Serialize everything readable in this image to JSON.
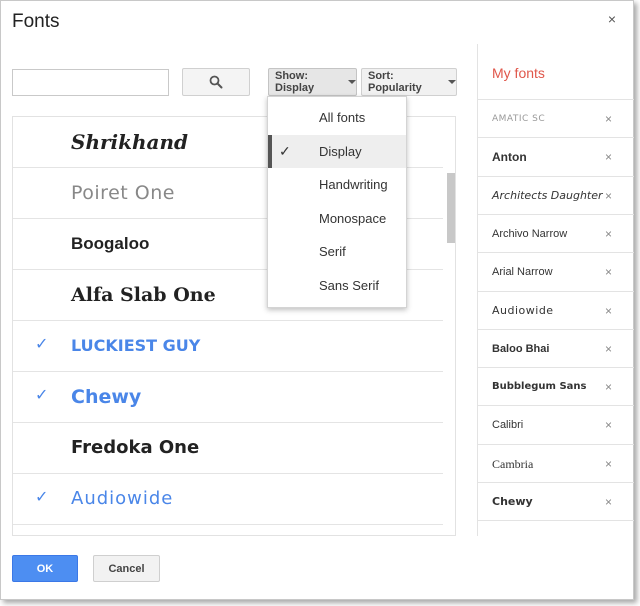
{
  "dialog": {
    "title": "Fonts",
    "close_icon": "×"
  },
  "search": {
    "value": "",
    "placeholder": "",
    "button_icon": "search-icon"
  },
  "filters": {
    "show_label": "Show: Display",
    "sort_label": "Sort: Popularity",
    "show_menu": [
      {
        "label": "All fonts",
        "checked": false
      },
      {
        "label": "Display",
        "checked": true
      },
      {
        "label": "Handwriting",
        "checked": false
      },
      {
        "label": "Monospace",
        "checked": false
      },
      {
        "label": "Serif",
        "checked": false
      },
      {
        "label": "Sans Serif",
        "checked": false
      }
    ],
    "check_glyph": "✓"
  },
  "font_list": [
    {
      "name": "Shrikhand",
      "selected": false
    },
    {
      "name": "Poiret One",
      "selected": false
    },
    {
      "name": "Boogaloo",
      "selected": false
    },
    {
      "name": "Alfa Slab One",
      "selected": false
    },
    {
      "name": "LUCKIEST GUY",
      "selected": true
    },
    {
      "name": "Chewy",
      "selected": true
    },
    {
      "name": "Fredoka One",
      "selected": false
    },
    {
      "name": "Audiowide",
      "selected": true
    }
  ],
  "my_fonts": {
    "title": "My fonts",
    "remove_glyph": "×",
    "items": [
      "AMATIC SC",
      "Anton",
      "Architects Daughter",
      "Archivo Narrow",
      "Arial Narrow",
      "Audiowide",
      "Baloo Bhai",
      "Bubblegum Sans",
      "Calibri",
      "Cambria",
      "Chewy"
    ]
  },
  "footer": {
    "ok_label": "OK",
    "cancel_label": "Cancel"
  },
  "colors": {
    "accent_blue": "#4a86e8",
    "my_fonts_title": "#e0574b",
    "ok_button": "#4d8ef2"
  }
}
